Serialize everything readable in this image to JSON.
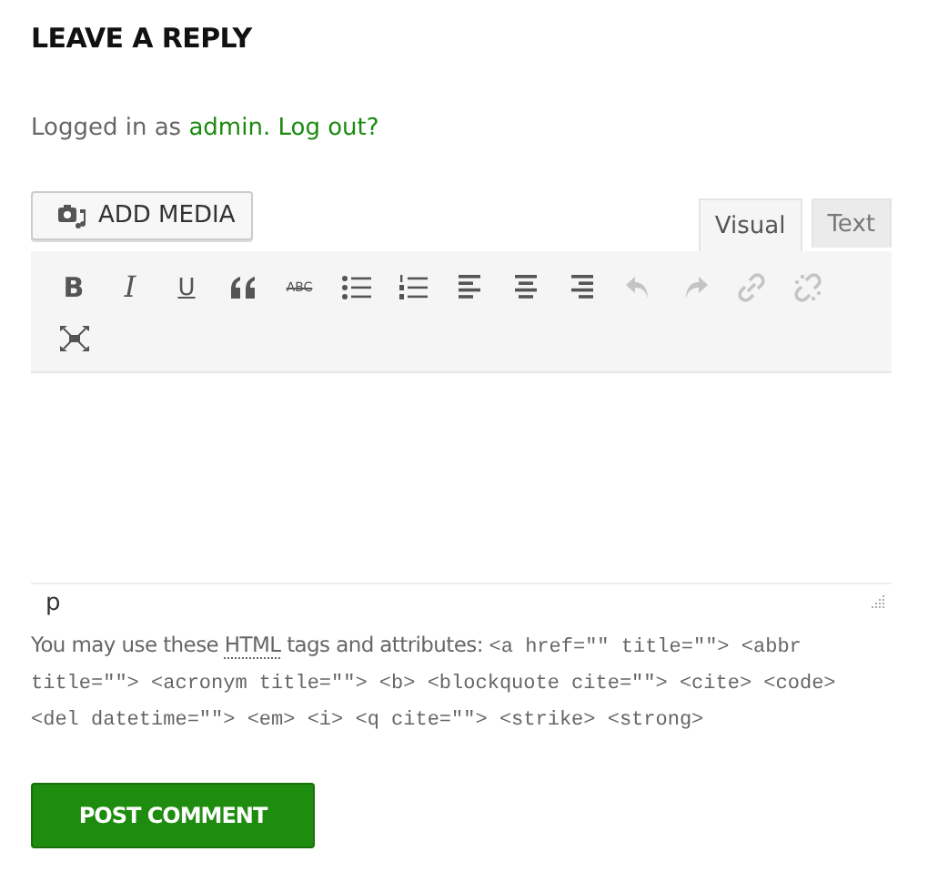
{
  "heading": "LEAVE A REPLY",
  "login": {
    "prefix": "Logged in as ",
    "user": "admin.",
    "logout": "Log out?"
  },
  "add_media": {
    "label": "ADD MEDIA"
  },
  "tabs": [
    {
      "label": "Visual",
      "selected": true
    },
    {
      "label": "Text",
      "selected": false
    }
  ],
  "toolbar": [
    {
      "kind": "bold",
      "glyph": "B",
      "disabled": false
    },
    {
      "kind": "italic",
      "glyph": "I",
      "disabled": false
    },
    {
      "kind": "underline",
      "glyph": "U",
      "disabled": false
    },
    {
      "kind": "quote",
      "disabled": false
    },
    {
      "kind": "strike",
      "glyph": "ABC",
      "disabled": false
    },
    {
      "kind": "bullets",
      "disabled": false
    },
    {
      "kind": "numbers",
      "disabled": false
    },
    {
      "kind": "align-left",
      "disabled": false
    },
    {
      "kind": "align-center",
      "disabled": false
    },
    {
      "kind": "align-right",
      "disabled": false
    },
    {
      "kind": "undo",
      "disabled": true
    },
    {
      "kind": "redo",
      "disabled": true
    },
    {
      "kind": "link",
      "disabled": true
    },
    {
      "kind": "unlink",
      "disabled": true
    },
    {
      "kind": "fullscreen",
      "disabled": false
    }
  ],
  "status_path": "p",
  "note": {
    "before": "You may use these ",
    "abbr": "HTML",
    "after": " tags and attributes: ",
    "code": "<a href=\"\" title=\"\"> <abbr title=\"\"> <acronym title=\"\"> <b> <blockquote cite=\"\"> <cite> <code> <del datetime=\"\"> <em> <i> <q cite=\"\"> <strike> <strong>"
  },
  "submit": {
    "label": "POST COMMENT"
  }
}
